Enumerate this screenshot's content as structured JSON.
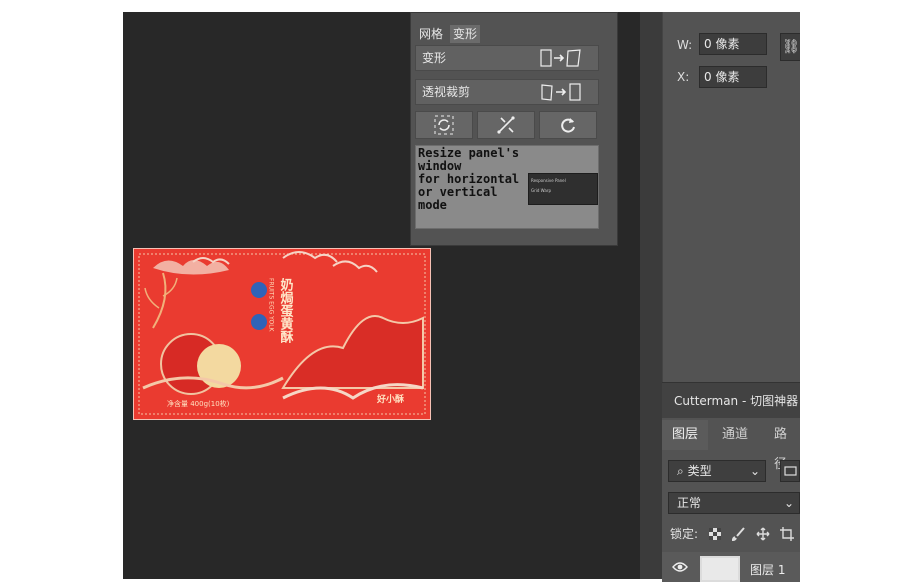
{
  "plugin": {
    "tabs": [
      "网格",
      "变形"
    ],
    "active_tab": "变形",
    "buttons": [
      {
        "label": "变形",
        "icon": "transform-arrow-icon"
      },
      {
        "label": "透视裁剪",
        "icon": "perspective-crop-arrow-icon"
      }
    ],
    "icon_buttons": [
      "rotate-frame-icon",
      "warp-tools-icon",
      "reset-icon"
    ],
    "tip": "Resize panel's window\nfor horizontal\nor vertical\nmode",
    "thumb_lines": [
      "Responsive Panel",
      "Grid   Warp"
    ]
  },
  "properties": {
    "w_label": "W:",
    "w_value": "0 像素",
    "x_label": "X:",
    "x_value": "0 像素",
    "link_icon": "link-icon"
  },
  "layers_panel": {
    "title": "Cutterman - 切图神器",
    "tabs": [
      "图层",
      "通道",
      "路径"
    ],
    "active_tab": "图层",
    "filter_label": "类型",
    "blend_mode": "正常",
    "lock_label": "锁定:",
    "layer_name": "图层 1",
    "colors": {
      "panel": "#535353",
      "canvas": "#282828"
    }
  },
  "artwork": {
    "title_text": "奶焗蛋黄酥",
    "brand_text": "好小",
    "side_text": "FRUITS EGG YOLK",
    "footer_text": "净含量 400g(10枚)",
    "logo_text": "好小酥",
    "colors": {
      "red": "#e8342c",
      "gold": "#f3d9a0"
    }
  }
}
